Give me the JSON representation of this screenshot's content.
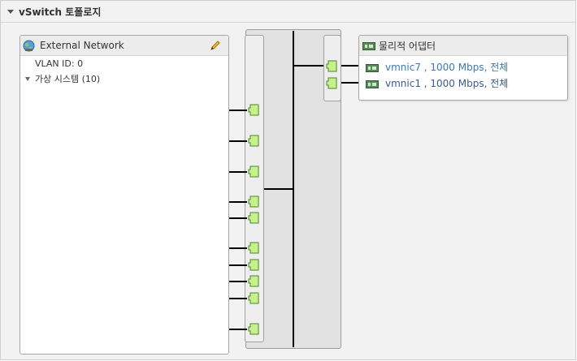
{
  "panel": {
    "title": "vSwitch 토폴로지"
  },
  "portgroup": {
    "name": "External Network",
    "vlan": "VLAN ID: 0",
    "vm_systems": "가상 시스템 (10)"
  },
  "adapters": {
    "title": "물리적 어댑터",
    "items": [
      {
        "label": "vmnic7 , 1000 Mbps, 전체",
        "color": "#3c78b4"
      },
      {
        "label": "vmnic1 , 1000 Mbps, 전체",
        "color": "#3c5a8c"
      }
    ]
  },
  "colors": {
    "port_fill": "#c8f08c",
    "port_stroke": "#4a8a2a",
    "accent": "#3c78b4"
  },
  "icons": [
    "collapse-caret-icon",
    "globe-network-icon",
    "pencil-edit-icon",
    "expand-caret-icon",
    "nic-icon",
    "port-icon"
  ],
  "counts": {
    "vm_ports": 10,
    "uplink_ports": 2
  }
}
